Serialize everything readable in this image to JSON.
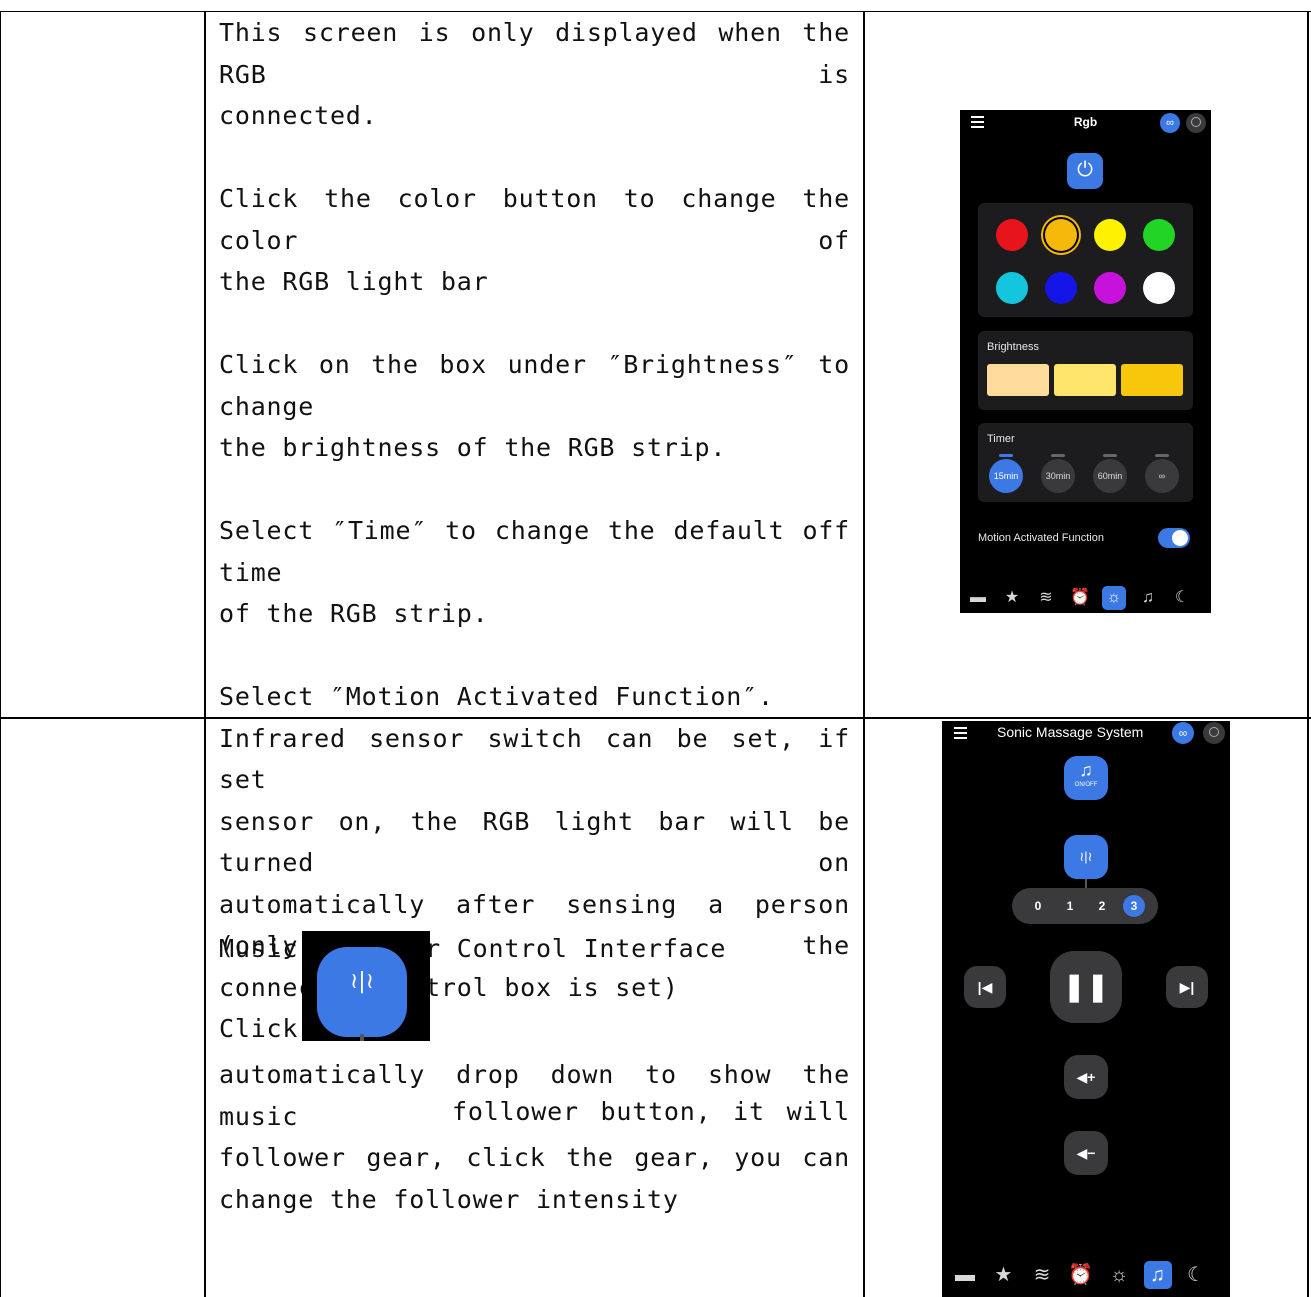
{
  "row1": {
    "lines": [
      {
        "text": "This screen is only displayed when the RGB is",
        "justify": true
      },
      {
        "text": "connected.",
        "justify": false
      },
      {
        "text": "",
        "gap": true
      },
      {
        "text": "Click the color button to change the color of",
        "justify": true
      },
      {
        "text": "the RGB light bar",
        "justify": false
      },
      {
        "text": "",
        "gap": true
      },
      {
        "text": "Click on the box under ″Brightness″ to change",
        "justify": true
      },
      {
        "text": "the brightness of the RGB strip.",
        "justify": false
      },
      {
        "text": "",
        "gap": true
      },
      {
        "text": "Select ″Time″ to change the default off time",
        "justify": true
      },
      {
        "text": "of the RGB strip.",
        "justify": false
      },
      {
        "text": "",
        "gap": true
      },
      {
        "text": "Select ″Motion Activated Function″.",
        "justify": false
      },
      {
        "text": "Infrared sensor switch can be set, if set",
        "justify": true
      },
      {
        "text": "sensor on, the RGB light bar will be turned on",
        "justify": true
      },
      {
        "text": "automatically after sensing a person (only the",
        "justify": true
      },
      {
        "text": "connected control box is set)",
        "justify": false
      }
    ]
  },
  "row2": {
    "heading": "Music Vibrator Control Interface",
    "click_word": "Click",
    "line1_rest": "follower button, it will",
    "lines": [
      {
        "text": "automatically drop down to show the music",
        "justify": true
      },
      {
        "text": "follower gear, click the gear, you can",
        "justify": true
      },
      {
        "text": "change the follower intensity",
        "justify": false
      }
    ]
  },
  "rgb_phone": {
    "title": "Rgb",
    "colors": [
      "#e8141b",
      "#f6b80a",
      "#fff200",
      "#22d426",
      "#13c6de",
      "#1515e8",
      "#c712dc",
      "#ffffff"
    ],
    "selected_color_index": 1,
    "brightness_label": "Brightness",
    "brightness_swatches": [
      "#fedb9a",
      "#fde46a",
      "#f8c60b"
    ],
    "timer_label": "Timer",
    "timer_options": [
      "15min",
      "30min",
      "60min",
      "∞"
    ],
    "timer_selected_index": 0,
    "motion_label": "Motion Activated Function",
    "motion_on": true,
    "accent": "#3d79e4",
    "nav_icons": [
      "bed-icon",
      "star-icon",
      "waves-icon",
      "alarm-icon",
      "light-icon",
      "music-icon",
      "moon-icon"
    ],
    "nav_active_index": 4
  },
  "music_phone": {
    "title": "Sonic Massage System",
    "power_label": "ON/OFF",
    "gears": [
      "0",
      "1",
      "2",
      "3"
    ],
    "gear_selected_index": 3,
    "nav_icons": [
      "bed-icon",
      "star-icon",
      "waves-icon",
      "alarm-icon",
      "light-icon",
      "music-icon",
      "moon-icon"
    ],
    "nav_active_index": 5
  }
}
